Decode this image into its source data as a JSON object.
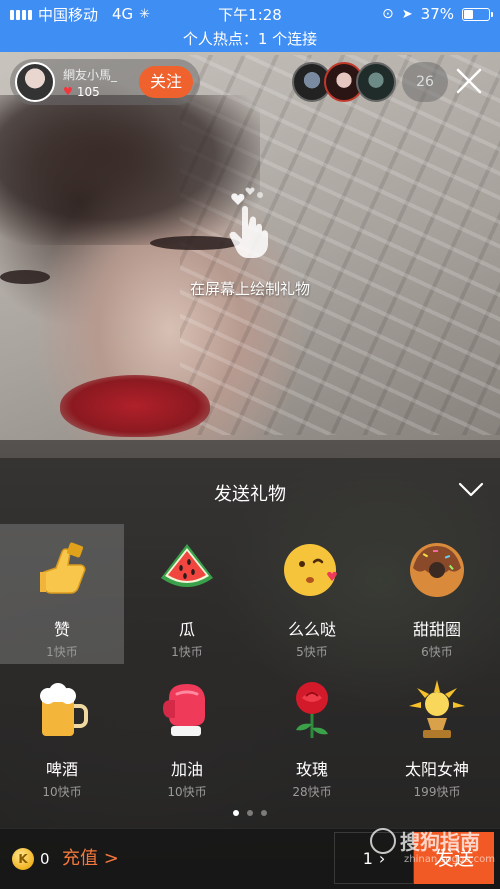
{
  "status_bar": {
    "carrier": "中国移动",
    "network": "4G",
    "time": "下午1:28",
    "battery": "37%"
  },
  "hotspot_text": "个人热点：1 个连接",
  "host": {
    "name": "網友小馬_",
    "likes": "105",
    "follow_label": "关注"
  },
  "viewers": {
    "count": "26"
  },
  "draw_hint": "在屏幕上绘制礼物",
  "gift_panel": {
    "title": "发送礼物",
    "gifts": [
      {
        "name": "赞",
        "price": "1快币",
        "icon": "thumbs-up-icon"
      },
      {
        "name": "瓜",
        "price": "1快币",
        "icon": "watermelon-icon"
      },
      {
        "name": "么么哒",
        "price": "5快币",
        "icon": "kiss-face-icon"
      },
      {
        "name": "甜甜圈",
        "price": "6快币",
        "icon": "donut-icon"
      },
      {
        "name": "啤酒",
        "price": "10快币",
        "icon": "beer-icon"
      },
      {
        "name": "加油",
        "price": "10快币",
        "icon": "boxing-glove-icon"
      },
      {
        "name": "玫瑰",
        "price": "28快币",
        "icon": "rose-icon"
      },
      {
        "name": "太阳女神",
        "price": "199快币",
        "icon": "sun-goddess-icon"
      }
    ],
    "page_count": 3,
    "current_page": 1
  },
  "bottom_bar": {
    "coin_balance": "0",
    "recharge_label": "充值 >",
    "quantity": "1",
    "send_label": "发送"
  },
  "watermark": {
    "brand": "搜狗指南",
    "url": "zhinan.sogou.com"
  },
  "colors": {
    "status_bar_bg": "#3f8ef3",
    "accent_orange": "#f15a24",
    "like_red": "#f3363d"
  }
}
